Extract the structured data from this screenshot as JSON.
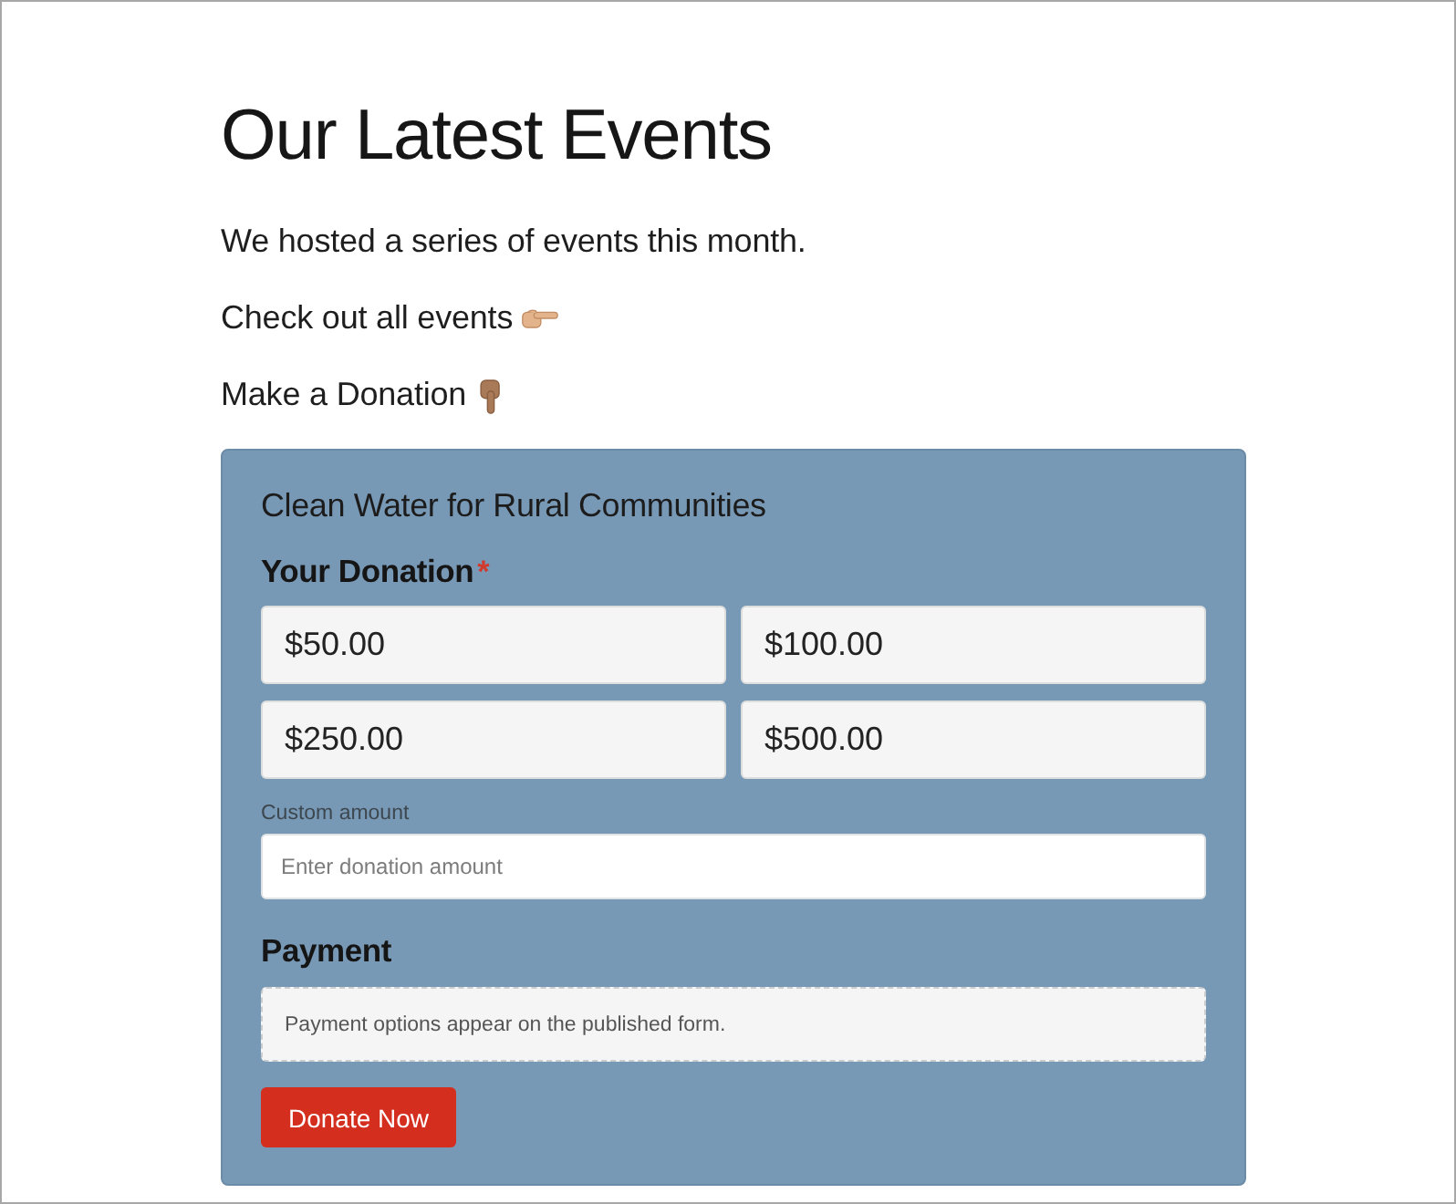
{
  "page": {
    "heading": "Our Latest Events",
    "paragraphs": [
      {
        "text": "We hosted a series of events this month.",
        "kind": "plain"
      },
      {
        "text": "Check out all events",
        "kind": "right"
      },
      {
        "text": "Make a Donation",
        "kind": "down"
      }
    ]
  },
  "donation_form": {
    "title": "Clean Water for Rural Communities",
    "amount_label": "Your Donation",
    "required_mark": "*",
    "amounts": [
      "$50.00",
      "$100.00",
      "$250.00",
      "$500.00"
    ],
    "custom_amount": {
      "label": "Custom amount",
      "placeholder": "Enter donation amount"
    },
    "payment": {
      "heading": "Payment",
      "notice": "Payment options appear on the published form."
    },
    "submit_button": "Donate Now"
  }
}
